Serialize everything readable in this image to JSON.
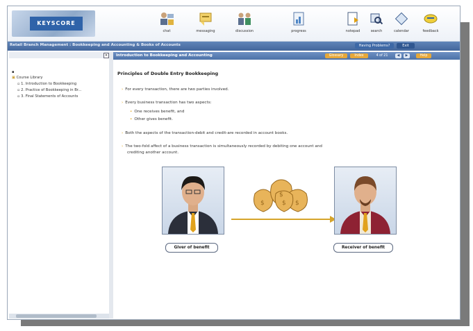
{
  "toolbar": {
    "logo_text": "KEYSCORE",
    "items": [
      {
        "label": "chat",
        "icon": "chat-icon"
      },
      {
        "label": "messaging",
        "icon": "messaging-icon"
      },
      {
        "label": "discussion",
        "icon": "discussion-icon"
      },
      {
        "label": "progress",
        "icon": "progress-icon"
      },
      {
        "label": "notepad",
        "icon": "notepad-icon"
      },
      {
        "label": "search",
        "icon": "search-icon"
      },
      {
        "label": "calendar",
        "icon": "calendar-icon"
      },
      {
        "label": "feedback",
        "icon": "feedback-icon"
      }
    ]
  },
  "breadcrumb": {
    "text": "Retail Branch Management : Bookkeeping and Accounting & Books of Accounts",
    "buttons": [
      "Having Problems?",
      "Exit"
    ]
  },
  "tree": {
    "root": "Course Library",
    "items": [
      "1. Introduction to Bookkeeping",
      "2. Practice of Bookkeeping in Br...",
      "3. Final Statements of Accounts"
    ]
  },
  "content_header": {
    "title": "Introduction to Bookkeeping and Accounting",
    "glossary": "Glossary",
    "index": "Index",
    "page": "4 of 21",
    "prev_icon": "prev-arrow-icon",
    "next_icon": "next-arrow-icon",
    "help": "Help"
  },
  "content": {
    "title": "Principles of Double Entry Bookkeeping",
    "bullets": [
      "For every transaction, there are two parties involved.",
      "Every business transaction has two aspects:",
      "Both the aspects of the transaction-debit and credit-are recorded in account books.",
      "The two-fold affect of a business transaction is simultaneously recorded by debiting one account and"
    ],
    "bullet4_line2": "crediting another account.",
    "sub_bullets": [
      "One receives benefit, and",
      "Other gives benefit."
    ],
    "giver_label": "Giver of benefit",
    "receiver_label": "Receiver of benefit"
  },
  "colors": {
    "header_blue": "#4d72a8",
    "bullet_orange": "#e0a010",
    "arrow_gold": "#d6a42a"
  }
}
